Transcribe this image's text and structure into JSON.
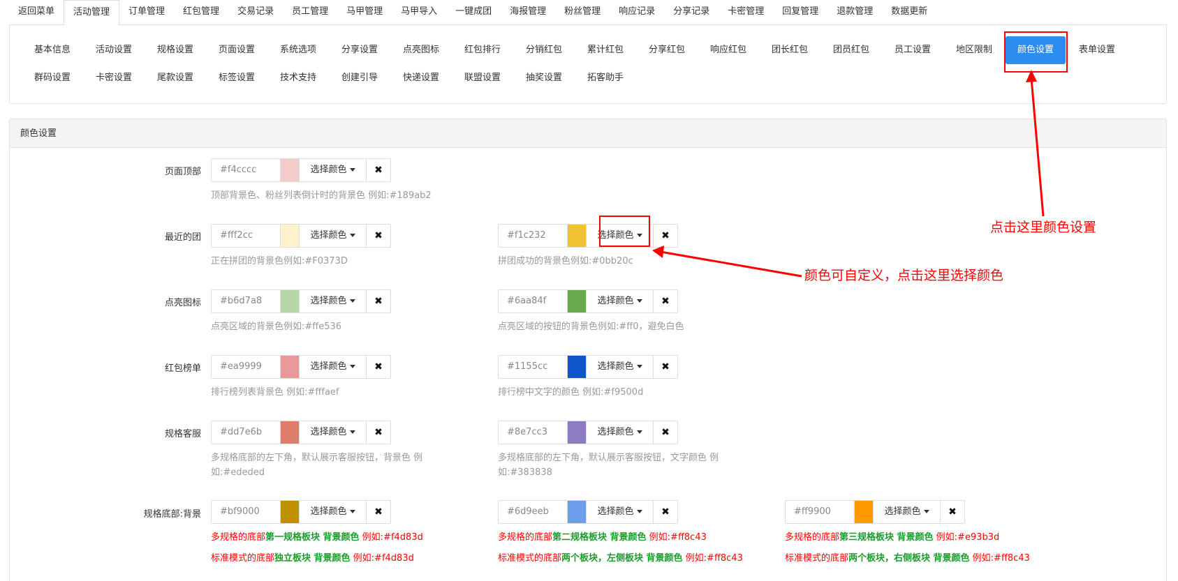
{
  "topnav": {
    "tabs": [
      "返回菜单",
      "活动管理",
      "订单管理",
      "红包管理",
      "交易记录",
      "员工管理",
      "马甲管理",
      "马甲导入",
      "一键成团",
      "海报管理",
      "粉丝管理",
      "响应记录",
      "分享记录",
      "卡密管理",
      "回复管理",
      "退款管理",
      "数据更新"
    ],
    "active_index": 1
  },
  "subnav": {
    "row1": [
      "基本信息",
      "活动设置",
      "规格设置",
      "页面设置",
      "系统选项",
      "分享设置",
      "点亮图标",
      "红包排行",
      "分销红包",
      "累计红包",
      "分享红包",
      "响应红包",
      "团长红包",
      "团员红包",
      "员工设置",
      "地区限制",
      "颜色设置",
      "表单设置"
    ],
    "row2": [
      "群码设置",
      "卡密设置",
      "尾款设置",
      "标签设置",
      "技术支持",
      "创建引导",
      "快递设置",
      "联盟设置",
      "抽奖设置",
      "拓客助手"
    ],
    "active": "颜色设置"
  },
  "panel": {
    "title": "颜色设置",
    "pick_label": "选择颜色",
    "clear_glyph": "✖",
    "rows": [
      {
        "label": "页面顶部",
        "fields": [
          {
            "value": "#f4cccc",
            "swatch": "#f4cccc",
            "help": "顶部背景色、粉丝列表倒计时的背景色 例如:#189ab2"
          }
        ]
      },
      {
        "label": "最近的团",
        "fields": [
          {
            "value": "#fff2cc",
            "swatch": "#fff2cc",
            "help": "正在拼团的背景色例如:#F0373D"
          },
          {
            "value": "#f1c232",
            "swatch": "#f1c232",
            "help": "拼团成功的背景色例如:#0bb20c"
          }
        ]
      },
      {
        "label": "点亮图标",
        "fields": [
          {
            "value": "#b6d7a8",
            "swatch": "#b6d7a8",
            "help": "点亮区域的背景色例如:#ffe536"
          },
          {
            "value": "#6aa84f",
            "swatch": "#6aa84f",
            "help": "点亮区域的按钮的背景色例如:#ff0，避免白色"
          }
        ]
      },
      {
        "label": "红包榜单",
        "fields": [
          {
            "value": "#ea9999",
            "swatch": "#ea9999",
            "help": "排行榜列表背景色 例如:#fffaef"
          },
          {
            "value": "#1155cc",
            "swatch": "#1155cc",
            "help": "排行榜中文字的颜色 例如:#f9500d"
          }
        ]
      },
      {
        "label": "规格客服",
        "fields": [
          {
            "value": "#dd7e6b",
            "swatch": "#dd7e6b",
            "help": "多规格底部的左下角，默认展示客服按钮，背景色 例如:#ededed"
          },
          {
            "value": "#8e7cc3",
            "swatch": "#8e7cc3",
            "help": "多规格底部的左下角，默认展示客服按钮，文字颜色 例如:#383838"
          }
        ]
      },
      {
        "label": "规格底部:背景",
        "fields": [
          {
            "value": "#bf9000",
            "swatch": "#bf9000",
            "help1": {
              "a": "多规格的底部",
              "b": "第一规格板块 背景颜色",
              "c": " 例如:#f4d83d"
            },
            "help2": {
              "a": "标准模式的底部",
              "b": "独立板块 背景颜色",
              "c": " 例如:#f4d83d"
            }
          },
          {
            "value": "#6d9eeb",
            "swatch": "#6d9eeb",
            "help1": {
              "a": "多规格的底部",
              "b": "第二规格板块 背景颜色",
              "c": " 例如:#ff8c43"
            },
            "help2": {
              "a": "标准模式的底部",
              "b": "两个板块，左侧板块 背景颜色",
              "c": " 例如:#ff8c43"
            }
          },
          {
            "value": "#ff9900",
            "swatch": "#ff9900",
            "help1": {
              "a": "多规格的底部",
              "b": "第三规格板块 背景颜色",
              "c": " 例如:#e93b3d"
            },
            "help2": {
              "a": "标准模式的底部",
              "b": "两个板块，右侧板块 背景颜色",
              "c": " 例如:#ff8c43"
            }
          }
        ]
      }
    ]
  },
  "annotations": {
    "click_color_settings": "点击这里颜色设置",
    "custom_color_hint": "颜色可自定义，点击这里选择颜色",
    "color": "#ff0000"
  }
}
